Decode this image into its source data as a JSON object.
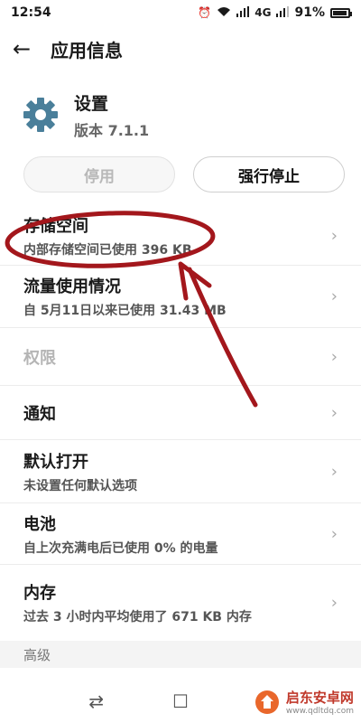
{
  "status": {
    "time": "12:54",
    "network": "4G",
    "battery": "91%",
    "battery_level": 0.91
  },
  "header": {
    "title": "应用信息"
  },
  "app": {
    "name": "设置",
    "version": "版本 7.1.1"
  },
  "buttons": {
    "disable": "停用",
    "force_stop": "强行停止"
  },
  "items": [
    {
      "label": "存储空间",
      "sub": "内部存储空间已使用 396 KB"
    },
    {
      "label": "流量使用情况",
      "sub": "自 5月11日以来已使用 31.43 MB"
    },
    {
      "label": "权限",
      "sub": ""
    },
    {
      "label": "通知",
      "sub": ""
    },
    {
      "label": "默认打开",
      "sub": "未设置任何默认选项"
    },
    {
      "label": "电池",
      "sub": "自上次充满电后已使用 0% 的电量"
    },
    {
      "label": "内存",
      "sub": "过去 3 小时内平均使用了 671 KB 内存"
    }
  ],
  "section": {
    "advanced": "高级"
  },
  "watermark": {
    "name": "启东安卓网",
    "url": "www.qdltdq.com"
  },
  "colors": {
    "annotation": "#a3171c"
  }
}
